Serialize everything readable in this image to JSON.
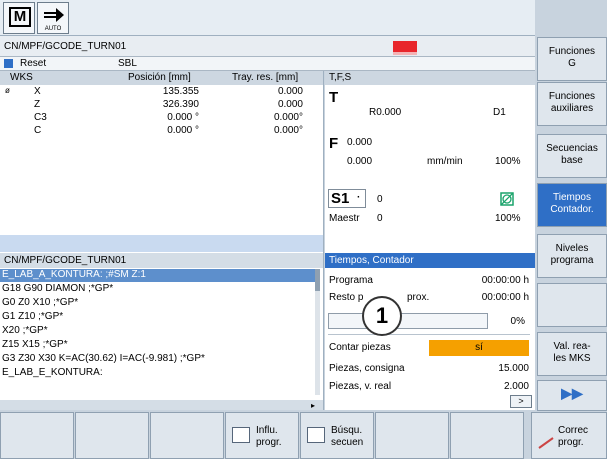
{
  "mode_buttons": {
    "m_label": "M",
    "auto_label": "AUTO"
  },
  "program": {
    "path": "CN/MPF/GCODE_TURN01",
    "reset_label": "Reset",
    "sbl_label": "SBL"
  },
  "wks": {
    "headers": [
      "WKS",
      "Posición [mm]",
      "Tray. res. [mm]"
    ],
    "rows": [
      {
        "axis": "X",
        "pos": "135.355",
        "res": "0.000"
      },
      {
        "axis": "Z",
        "pos": "326.390",
        "res": "0.000"
      },
      {
        "axis": "C3",
        "pos": "0.000 °",
        "res": "0.000°"
      },
      {
        "axis": "C",
        "pos": "0.000 °",
        "res": "0.000°"
      }
    ]
  },
  "tfs": {
    "header": "T,F,S",
    "t_label": "T",
    "r_value": "R0.000",
    "d_value": "D1",
    "f_label": "F",
    "f_value": "0.000",
    "f_value2": "0.000",
    "f_unit": "mm/min",
    "f_percent": "100%",
    "s_label": "S1",
    "s_value": "0",
    "maestr_label": "Maestr",
    "maestr_value": "0",
    "s_percent": "100%"
  },
  "listing": {
    "header": "CN/MPF/GCODE_TURN01",
    "lines": [
      "E_LAB_A_KONTURA: ;#SM Z:1",
      "G18 G90 DIAMON ;*GP*",
      "G0 Z0 X10 ;*GP*",
      "G1 Z10 ;*GP*",
      "X20 ;*GP*",
      "Z15 X15 ;*GP*",
      "G3 Z30 X30 K=AC(30.62) I=AC(-9.981) ;*GP*",
      "E_LAB_E_KONTURA:"
    ]
  },
  "times": {
    "header": "Tiempos, Contador",
    "programa_label": "Programa",
    "programa_value": "00:00:00 h",
    "resto_label": "Resto p",
    "resto_label2": "prox.",
    "resto_value": "00:00:00 h",
    "progress_percent": "0%",
    "progress_fraction": 0,
    "contar_label": "Contar piezas",
    "contar_value": "sí",
    "consigna_label": "Piezas, consigna",
    "consigna_value": "15.000",
    "real_label": "Piezas, v. real",
    "real_value": "2.000",
    "scroll_label": ">"
  },
  "callout": "1",
  "vertical_softkeys": [
    {
      "label1": "Funciones",
      "label2": "G",
      "active": false
    },
    {
      "label1": "Funciones",
      "label2": "auxiliares",
      "active": false
    },
    {
      "label1": "Secuencias",
      "label2": "base",
      "active": false
    },
    {
      "label1": "Tiempos",
      "label2": "Contador.",
      "active": true
    },
    {
      "label1": "Niveles",
      "label2": "programa",
      "active": false
    },
    {
      "label1": "",
      "label2": "",
      "active": false
    },
    {
      "label1": "Val. rea-",
      "label2": "les MKS",
      "active": false
    },
    {
      "label1": "",
      "label2": "",
      "active": false
    }
  ],
  "vsk_more_label": "▶▶",
  "horizontal_softkeys": [
    {
      "label1": "",
      "label2": ""
    },
    {
      "label1": "",
      "label2": ""
    },
    {
      "label1": "",
      "label2": ""
    },
    {
      "label1": "Influ.",
      "label2": "progr."
    },
    {
      "label1": "Búsqu.",
      "label2": "secuen"
    },
    {
      "label1": "",
      "label2": ""
    },
    {
      "label1": "",
      "label2": ""
    },
    {
      "label1": "Correc",
      "label2": "progr."
    }
  ],
  "colors": {
    "accent": "#2f6fc6",
    "alarm": "#e8262c",
    "orange": "#f5a000"
  }
}
